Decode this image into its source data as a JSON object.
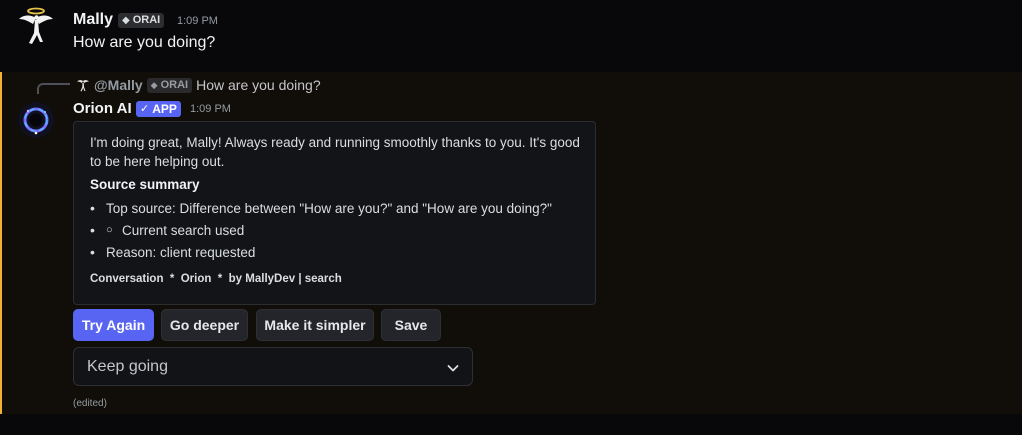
{
  "message1": {
    "username": "Mally",
    "tag": "ORAI",
    "timestamp": "1:09 PM",
    "content": "How are you doing?"
  },
  "message2": {
    "reply": {
      "mention": "@Mally",
      "tag": "ORAI",
      "text": "How are you doing?"
    },
    "username": "Orion AI",
    "app_tag": "APP",
    "timestamp": "1:09 PM",
    "accent_color": "#f0b232",
    "embed": {
      "description": "I'm doing great, Mally! Always ready and running smoothly thanks to you. It's good to be here helping out.",
      "heading": "Source summary",
      "bullets": [
        "Top source: Difference between \"How are you?\" and \"How are you doing?\"",
        "Current search used",
        "Reason: client requested"
      ],
      "footer": "Conversation  *  Orion  *  by MallyDev | search"
    },
    "buttons": {
      "try_again": "Try Again",
      "go_deeper": "Go deeper",
      "simpler": "Make it simpler",
      "save": "Save"
    },
    "select": {
      "value": "Keep going"
    },
    "edited": "(edited)"
  },
  "colors": {
    "brand": "#5865f2",
    "accent": "#f0b232"
  }
}
